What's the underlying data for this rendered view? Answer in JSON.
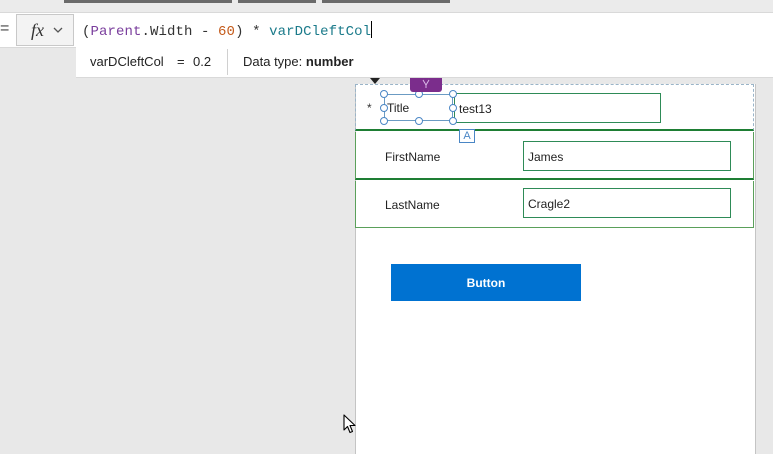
{
  "formula_bar": {
    "fx_label": "fx",
    "tokens": {
      "open_paren": "(",
      "parent": "Parent",
      "dot_width": ".Width - ",
      "number": "60",
      "close_part": ") * ",
      "variable": "varDCleftCol"
    }
  },
  "intellisense": {
    "name": "varDCleftCol",
    "equals": "=",
    "value": "0.2",
    "type_prefix": "Data type: ",
    "type_value": "number"
  },
  "form": {
    "title_card": {
      "required_mark": "*",
      "label": "Title",
      "value": "test13"
    },
    "first_card": {
      "label": "FirstName",
      "value": "James"
    },
    "last_card": {
      "label": "LastName",
      "value": "Cragle2"
    }
  },
  "badge_letter": "A",
  "button": {
    "label": "Button"
  },
  "colors": {
    "button_bg": "#0072d1",
    "card_border": "#1e7e34",
    "selection": "#4a86c5",
    "tag": "#7b2d8c"
  }
}
